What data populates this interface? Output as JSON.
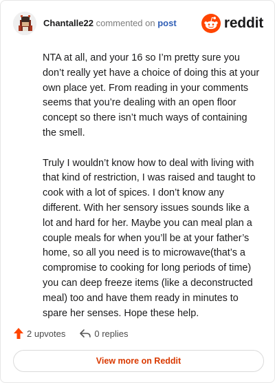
{
  "header": {
    "username": "Chantalle22",
    "verb": "commented on",
    "target": "post",
    "brand": "reddit"
  },
  "comment": {
    "paragraphs": [
      "NTA at all, and your 16 so I’m pretty sure you don’t really yet have a choice of doing this at your own place yet. From reading in your comments seems that you’re dealing with an open floor concept so there isn’t much ways of containing the smell.",
      "Truly I wouldn’t know how to deal with living with that kind of restriction, I was raised and taught to cook with a lot of spices. I don’t know any different. With her sensory issues sounds like a lot and hard for her. Maybe you can meal plan a couple meals for when you’ll be at your father’s home, so all you need is to microwave(that’s a compromise to cooking for long periods of time) you can deep freeze items (like a deconstructed meal) too and have them ready in minutes to spare her senses. Hope these help."
    ]
  },
  "actions": {
    "upvotes": "2 upvotes",
    "replies": "0 replies"
  },
  "footer": {
    "view_more": "View more on Reddit"
  },
  "colors": {
    "brand_orange": "#ff4500",
    "link_blue": "#2f5eb6",
    "button_text": "#d93900"
  },
  "icons": [
    "avatar",
    "reddit-logo-icon",
    "upvote-arrow-icon",
    "reply-arrow-icon"
  ]
}
